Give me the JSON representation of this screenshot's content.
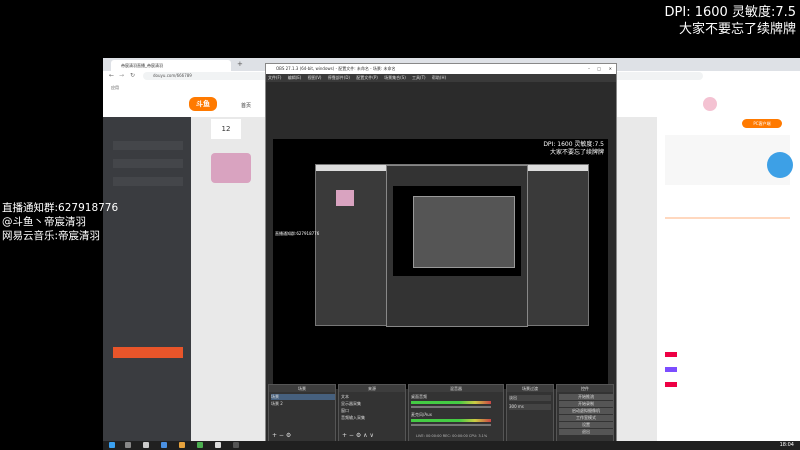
{
  "overlay": {
    "dpi_line": "DPI: 1600 灵敏度:7.5",
    "reminder": "大家不要忘了续牌牌",
    "fan_group": "直播通知群:627918776",
    "douyu_handle": "@斗鱼丶帝宸清羽",
    "netease_music": "网易云音乐:帝宸清羽"
  },
  "browser": {
    "tab_title": "帝宸清羽直播_帝宸清羽",
    "url": "douyu.com/666789",
    "bookmark_apps": "应用"
  },
  "site": {
    "nav_home": "首页",
    "follow_count": "12",
    "right_button": "PC客户端"
  },
  "obs": {
    "title": "OBS 27.1.3 (64-bit, windows) - 配置文件: 未命名 - 场景: 未命名",
    "menu": [
      "文件(F)",
      "编辑(E)",
      "视图(V)",
      "停靠部件(D)",
      "配置文件(P)",
      "场景集合(S)",
      "工具(T)",
      "帮助(H)"
    ],
    "docks": {
      "scenes": "场景",
      "sources": "来源",
      "mixer": "混音器",
      "transitions": "场景过渡",
      "controls": "控件"
    },
    "scene_items": [
      "场景",
      "场景 2"
    ],
    "source_items": [
      "文本",
      "显示器采集",
      "窗口",
      "音频输入采集"
    ],
    "mixer_tracks": [
      "桌面音频",
      "麦克风/Aux"
    ],
    "transition_type": "淡出",
    "transition_duration": "300 ms",
    "controls": [
      "开始推流",
      "开始录制",
      "启动虚拟摄像机",
      "工作室模式",
      "设置",
      "退出"
    ],
    "status": "LIVE: 00:00:00  REC: 00:00:00  CPU: 3.1%"
  },
  "taskbar": {
    "clock": "18:04"
  },
  "colors": {
    "douyu_orange": "#ff7a00",
    "obs_bg": "#2b2b2b",
    "sidebar_dark": "#3a3c40"
  }
}
